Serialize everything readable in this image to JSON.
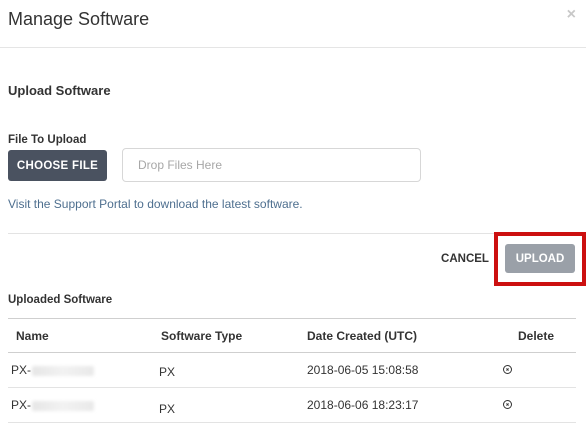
{
  "modal": {
    "title": "Manage Software",
    "close_label": "×"
  },
  "upload": {
    "section_title": "Upload Software",
    "field_label": "File To Upload",
    "choose_label": "CHOOSE FILE",
    "drop_placeholder": "Drop Files Here",
    "support_link": "Visit the Support Portal to download the latest software."
  },
  "actions": {
    "cancel_label": "CANCEL",
    "upload_label": "UPLOAD",
    "highlight_color": "#cc1010"
  },
  "uploaded": {
    "title": "Uploaded Software",
    "columns": [
      "Name",
      "Software Type",
      "Date Created (UTC)",
      "Delete"
    ],
    "rows": [
      {
        "name": "PX-",
        "type": "PX",
        "date": "2018-06-05 15:08:58"
      },
      {
        "name": "PX-",
        "type": "PX",
        "date": "2018-06-06 18:23:17"
      }
    ]
  }
}
